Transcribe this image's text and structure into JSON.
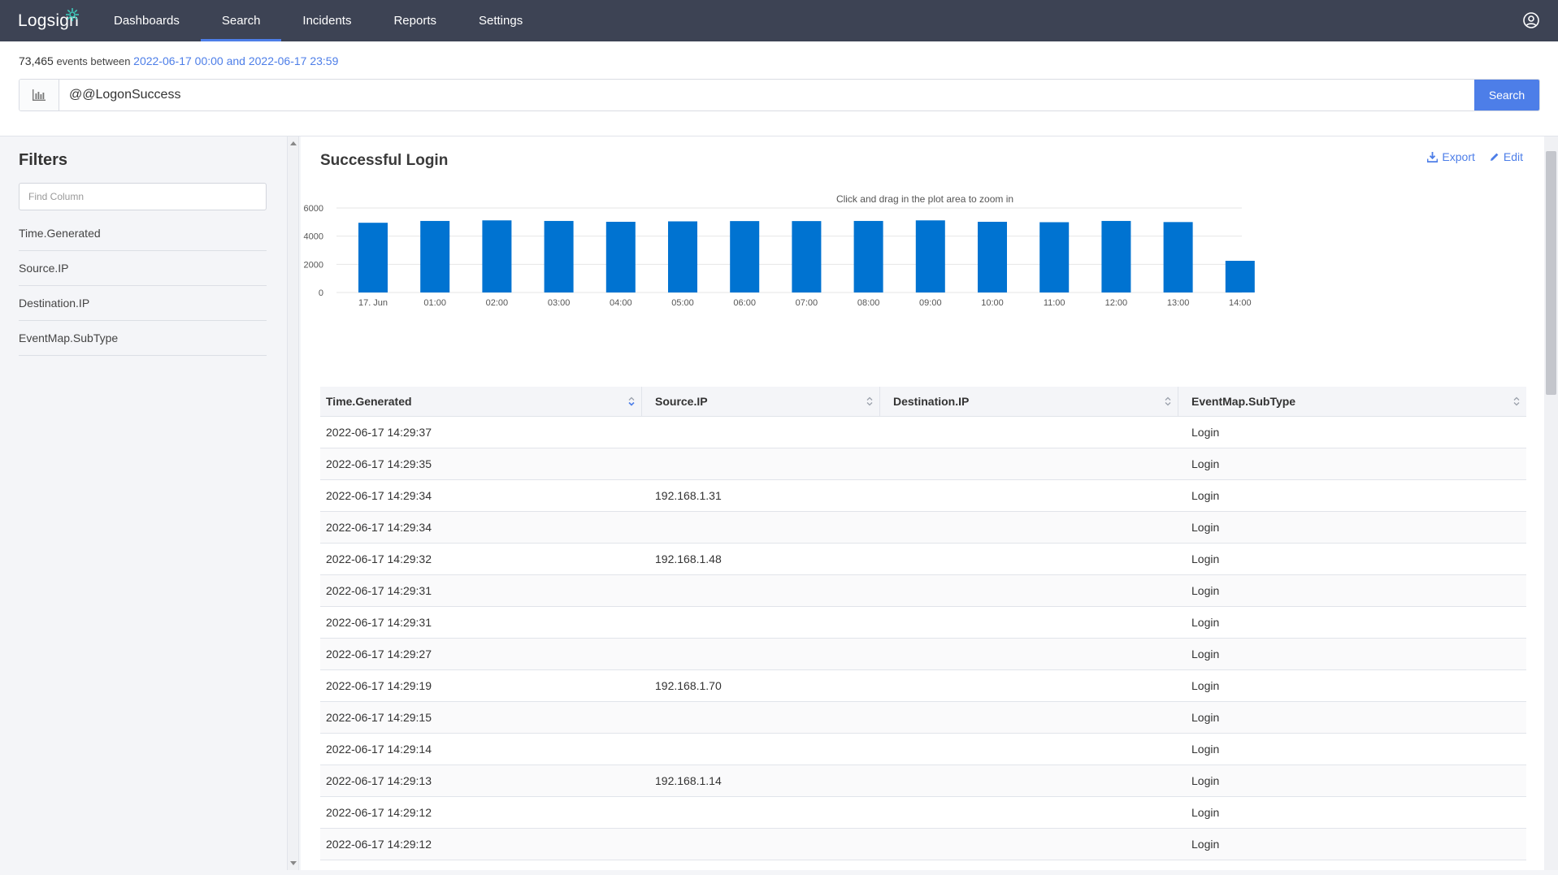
{
  "nav": {
    "logo": "Logsign",
    "items": [
      "Dashboards",
      "Search",
      "Incidents",
      "Reports",
      "Settings"
    ],
    "active": "Search"
  },
  "summary": {
    "count": "73,465",
    "label": "events between",
    "range": "2022-06-17 00:00 and 2022-06-17 23:59"
  },
  "search": {
    "query": "@@LogonSuccess",
    "button": "Search"
  },
  "filters": {
    "title": "Filters",
    "find_placeholder": "Find Column",
    "columns": [
      "Time.Generated",
      "Source.IP",
      "Destination.IP",
      "EventMap.SubType"
    ]
  },
  "panel": {
    "title": "Successful Login",
    "export_label": "Export",
    "edit_label": "Edit",
    "hint": "Click and drag in the plot area to zoom in"
  },
  "chart_data": {
    "type": "bar",
    "categories": [
      "17. Jun",
      "01:00",
      "02:00",
      "03:00",
      "04:00",
      "05:00",
      "06:00",
      "07:00",
      "08:00",
      "09:00",
      "10:00",
      "11:00",
      "12:00",
      "13:00",
      "14:00"
    ],
    "values": [
      4950,
      5080,
      5120,
      5080,
      5020,
      5050,
      5070,
      5070,
      5080,
      5120,
      5020,
      4990,
      5080,
      5000,
      2250
    ],
    "yticks": [
      0,
      2000,
      4000,
      6000
    ],
    "ylim": [
      0,
      6000
    ],
    "color": "#0073d1",
    "title": "",
    "xlabel": "",
    "ylabel": ""
  },
  "table": {
    "headers": [
      "Time.Generated",
      "Source.IP",
      "Destination.IP",
      "EventMap.SubType"
    ],
    "rows": [
      [
        "2022-06-17 14:29:37",
        "",
        "",
        "Login"
      ],
      [
        "2022-06-17 14:29:35",
        "",
        "",
        "Login"
      ],
      [
        "2022-06-17 14:29:34",
        "192.168.1.31",
        "",
        "Login"
      ],
      [
        "2022-06-17 14:29:34",
        "",
        "",
        "Login"
      ],
      [
        "2022-06-17 14:29:32",
        "192.168.1.48",
        "",
        "Login"
      ],
      [
        "2022-06-17 14:29:31",
        "",
        "",
        "Login"
      ],
      [
        "2022-06-17 14:29:31",
        "",
        "",
        "Login"
      ],
      [
        "2022-06-17 14:29:27",
        "",
        "",
        "Login"
      ],
      [
        "2022-06-17 14:29:19",
        "192.168.1.70",
        "",
        "Login"
      ],
      [
        "2022-06-17 14:29:15",
        "",
        "",
        "Login"
      ],
      [
        "2022-06-17 14:29:14",
        "",
        "",
        "Login"
      ],
      [
        "2022-06-17 14:29:13",
        "192.168.1.14",
        "",
        "Login"
      ],
      [
        "2022-06-17 14:29:12",
        "",
        "",
        "Login"
      ],
      [
        "2022-06-17 14:29:12",
        "",
        "",
        "Login"
      ]
    ]
  }
}
